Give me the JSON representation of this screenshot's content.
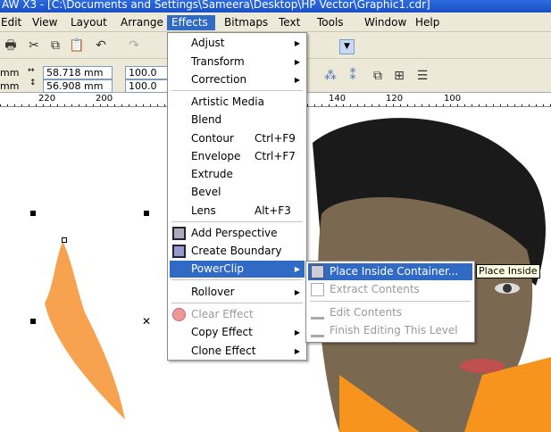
{
  "title": "AW X3 - [C:\\Documents and Settings\\Sameera\\Desktop\\HP Vector\\Graphic1.cdr]",
  "menubar": [
    "Edit",
    "View",
    "Layout",
    "Arrange",
    "Effects",
    "Bitmaps",
    "Text",
    "Tools",
    "Window",
    "Help"
  ],
  "propbar": {
    "unit_top": "mm",
    "unit_bottom": "mm",
    "width": "58.718 mm",
    "height": "56.908 mm",
    "scale_x": "100.0",
    "scale_y": "100.0"
  },
  "ruler": [
    "220",
    "200",
    "140",
    "120",
    "100"
  ],
  "effects_menu": [
    {
      "label": "Adjust",
      "arrow": "▶"
    },
    {
      "label": "Transform",
      "arrow": "▶"
    },
    {
      "label": "Correction",
      "arrow": "▶"
    },
    {
      "label": "Artistic Media"
    },
    {
      "label": "Blend"
    },
    {
      "label": "Contour",
      "shortcut": "Ctrl+F9"
    },
    {
      "label": "Envelope",
      "shortcut": "Ctrl+F7"
    },
    {
      "label": "Extrude"
    },
    {
      "label": "Bevel"
    },
    {
      "label": "Lens",
      "shortcut": "Alt+F3"
    },
    {
      "label": "Add Perspective"
    },
    {
      "label": "Create Boundary"
    },
    {
      "label": "PowerClip",
      "arrow": "▶"
    },
    {
      "label": "Rollover",
      "arrow": "▶"
    },
    {
      "label": "Clear Effect"
    },
    {
      "label": "Copy Effect",
      "arrow": "▶"
    },
    {
      "label": "Clone Effect",
      "arrow": "▶"
    }
  ],
  "powerclip_menu": [
    {
      "label": "Place Inside Container..."
    },
    {
      "label": "Extract Contents"
    },
    {
      "label": "Edit Contents"
    },
    {
      "label": "Finish Editing This Level"
    }
  ],
  "tooltip": "Place Inside",
  "colors": {
    "highlight": "#316ac5",
    "menubar": "#ece9d8",
    "shape": "#f7a24e"
  }
}
